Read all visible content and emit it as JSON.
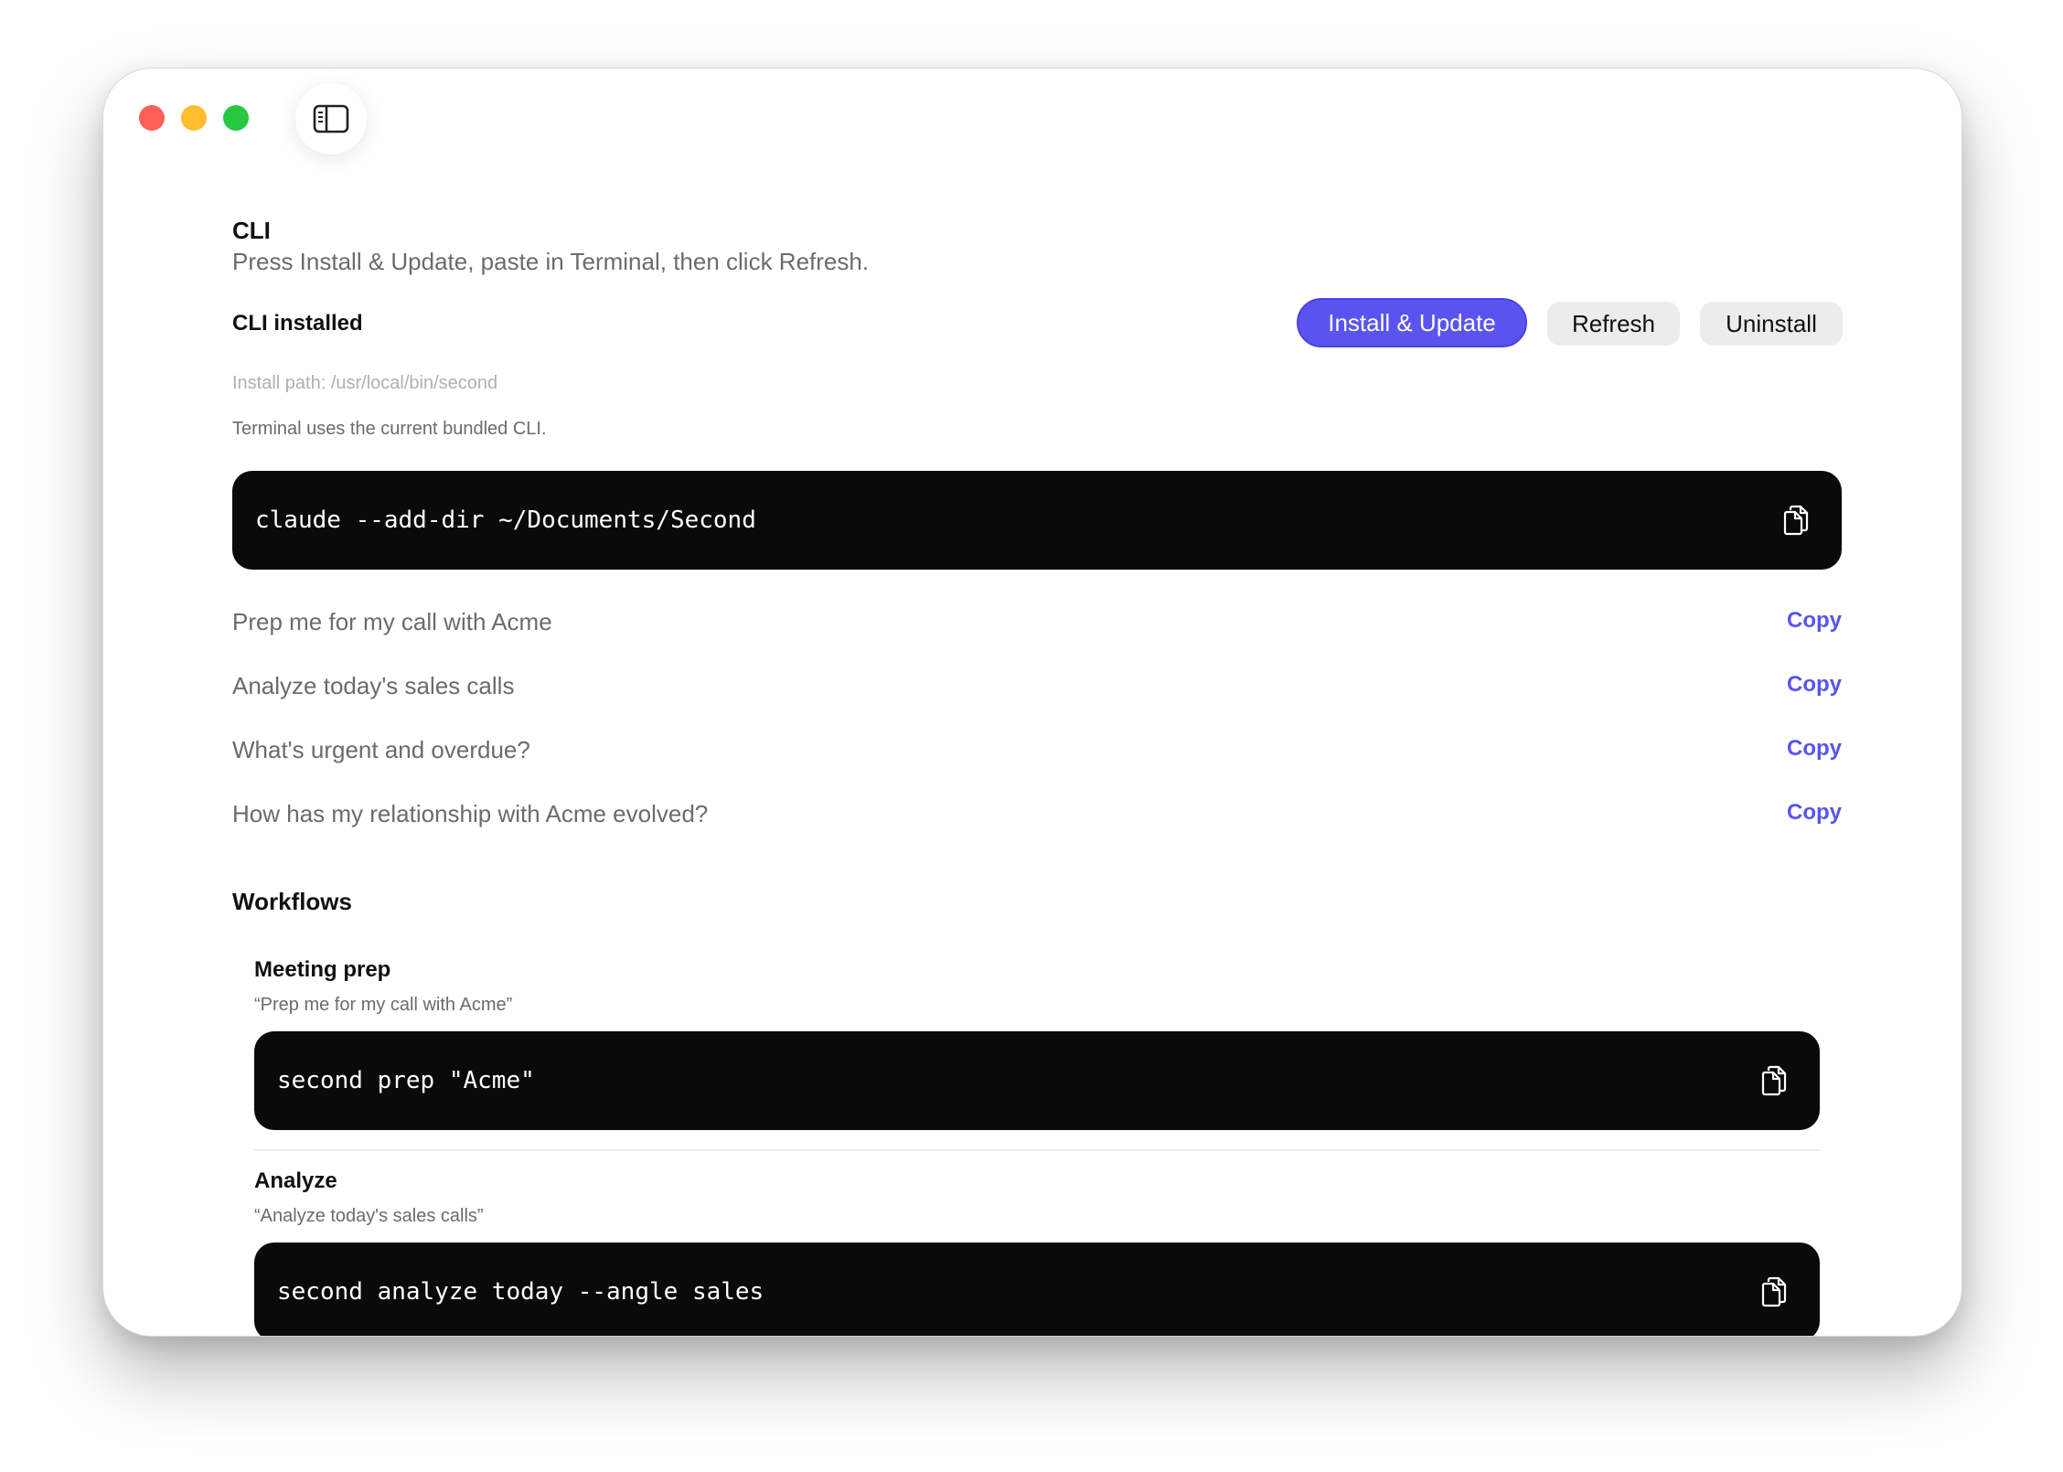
{
  "window": {
    "controls": [
      "close",
      "minimize",
      "zoom"
    ],
    "sidebar_toggle_icon": "sidebar-icon"
  },
  "cli": {
    "title": "CLI",
    "subtitle": "Press Install & Update, paste in Terminal, then click Refresh.",
    "status": "CLI installed",
    "buttons": {
      "install_update": "Install & Update",
      "refresh": "Refresh",
      "uninstall": "Uninstall"
    },
    "install_path": "Install path: /usr/local/bin/second",
    "terminal_note": "Terminal uses the current bundled CLI.",
    "command": "claude --add-dir ~/Documents/Second",
    "copy_icon": "copy-icon"
  },
  "prompts": [
    {
      "text": "Prep me for my call with Acme",
      "action": "Copy"
    },
    {
      "text": "Analyze today's sales calls",
      "action": "Copy"
    },
    {
      "text": "What's urgent and overdue?",
      "action": "Copy"
    },
    {
      "text": "How has my relationship with Acme evolved?",
      "action": "Copy"
    }
  ],
  "workflows": {
    "heading": "Workflows",
    "items": [
      {
        "title": "Meeting prep",
        "quote": "“Prep me for my call with Acme”",
        "command": "second prep \"Acme\""
      },
      {
        "title": "Analyze",
        "quote": "“Analyze today's sales calls”",
        "command": "second analyze today --angle sales"
      }
    ]
  },
  "colors": {
    "accent": "#5b53f0",
    "code_bg": "#0a0a0a",
    "muted_text": "#6b6b6b",
    "close": "#ff5f57",
    "minimize": "#febc2e",
    "zoom": "#28c840"
  }
}
